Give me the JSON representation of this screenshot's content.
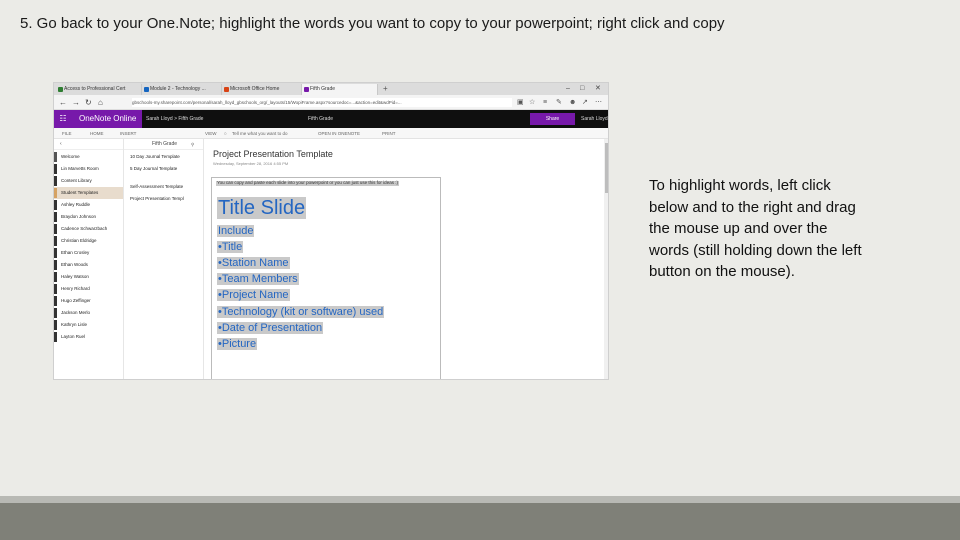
{
  "slide": {
    "title": "5. Go back to your One.Note; highlight the words you want to copy to your powerpoint; right click and copy",
    "instruction": "To highlight words, left click below and to the right and drag the mouse up and over the words (still holding down the left button on the mouse)."
  },
  "browser": {
    "tabs": [
      {
        "label": "Access to Professional Cert",
        "color": "#2e7d32"
      },
      {
        "label": "Module 2 - Technology ...",
        "color": "#1565c0"
      },
      {
        "label": "Microsoft Office Home",
        "color": "#d84315"
      },
      {
        "label": "Fifth Grade",
        "color": "#7719aa"
      }
    ],
    "url": "gbschools-my.sharepoint.com/personal/sarah_lloyd_gbschools_org/_layouts/15/WopiFrame.aspx?sourcedoc=...&action=edit&wdPid=..."
  },
  "onenote": {
    "app_name": "OneNote Online",
    "breadcrumb": "Sarah Lloyd > Fifth Grade",
    "doc_name": "Fifth Grade",
    "share_label": "Share",
    "user_name": "Sarah Lloyd",
    "ribbon": [
      "FILE",
      "HOME",
      "INSERT",
      "VIEW",
      "Tell me what you want to do",
      "OPEN IN ONENOTE",
      "PRINT"
    ],
    "notebook_label": "Fifth Grade",
    "sections": [
      {
        "label": "Welcome",
        "color": "#555555"
      },
      {
        "label": "Lin Marvetts Room",
        "color": "#333333"
      },
      {
        "label": "Content Library",
        "color": "#333333"
      },
      {
        "label": "Student Templates",
        "color": "#d5a263"
      },
      {
        "label": "Ashley Ruddle",
        "color": "#333333"
      },
      {
        "label": "Braydon Johnson",
        "color": "#333333"
      },
      {
        "label": "Cadence Schwarzbach",
        "color": "#333333"
      },
      {
        "label": "Christian Eldridge",
        "color": "#333333"
      },
      {
        "label": "Ethan Crosley",
        "color": "#333333"
      },
      {
        "label": "Ethan Woods",
        "color": "#333333"
      },
      {
        "label": "Haley Watson",
        "color": "#333333"
      },
      {
        "label": "Henry Richard",
        "color": "#333333"
      },
      {
        "label": "Hugo Zeffinger",
        "color": "#333333"
      },
      {
        "label": "Jackson Merlo",
        "color": "#333333"
      },
      {
        "label": "Kathryn Lisle",
        "color": "#333333"
      },
      {
        "label": "Layton Ruel",
        "color": "#333333"
      }
    ],
    "selected_section_index": 3,
    "pages": [
      "10 Day Journal Template",
      "5 Day Journal Template",
      "Self-Assessment Template",
      "Project Presentation Templ"
    ],
    "page": {
      "title": "Project Presentation Template",
      "date": "Wednesday, September 28, 2016   4:55 PM",
      "note": "You can copy and paste each slide into your powerpoint or you can just use this for ideas :)",
      "slide_title": "Title Slide",
      "items": [
        "Include",
        "•Title",
        "•Station Name",
        "•Team Members",
        "•Project Name",
        "•Technology (kit or software) used",
        "•Date of Presentation",
        "•Picture"
      ]
    }
  },
  "colors": {
    "accent": "#7719aa",
    "highlight": "#c9c9c9",
    "text_blue": "#2466c2"
  }
}
